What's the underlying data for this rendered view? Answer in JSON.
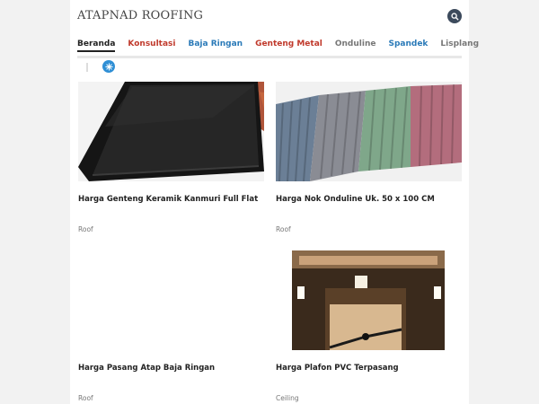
{
  "header": {
    "brand": "ATAPNAD ROOFING",
    "search_icon": "search-icon"
  },
  "nav": {
    "items": [
      {
        "label": "Beranda",
        "color": "#222222",
        "active": true
      },
      {
        "label": "Konsultasi",
        "color": "#c0392b"
      },
      {
        "label": "Baja Ringan",
        "color": "#2a7ab8"
      },
      {
        "label": "Genteng Metal",
        "color": "#c0392b"
      },
      {
        "label": "Onduline",
        "color": "#777777"
      },
      {
        "label": "Spandek",
        "color": "#2a7ab8"
      },
      {
        "label": "Lisplang",
        "color": "#777777"
      }
    ],
    "toggle_icon": "snowflake-icon"
  },
  "posts": [
    {
      "title": "Harga Genteng Keramik Kanmuri Full Flat",
      "category": "Roof",
      "image": "black-ceramic-roof-tile"
    },
    {
      "title": "Harga Nok Onduline Uk. 50 x 100 CM",
      "category": "Roof",
      "image": "colored-corrugated-onduline-sheets"
    },
    {
      "title": "Harga Pasang Atap Baja Ringan",
      "category": "Roof",
      "image": "blank"
    },
    {
      "title": "Harga Plafon PVC Terpasang",
      "category": "Ceiling",
      "image": "pvc-ceiling-with-fan"
    }
  ]
}
